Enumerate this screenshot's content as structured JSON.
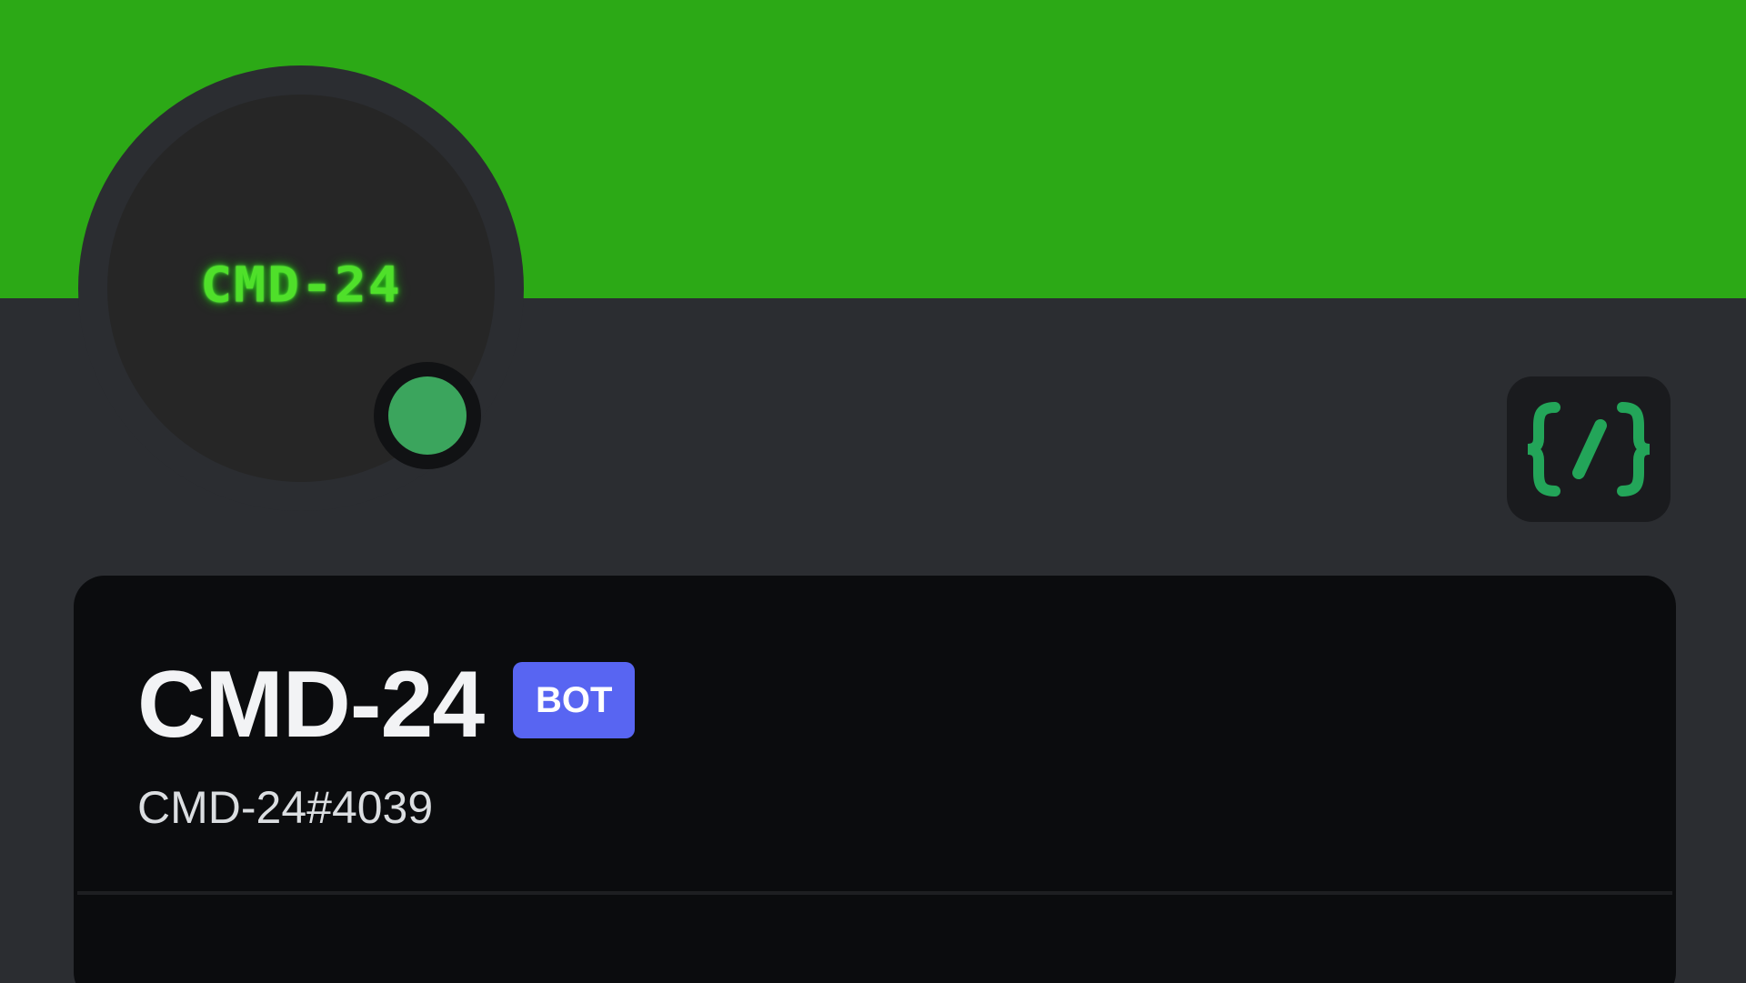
{
  "banner": {
    "color": "#2ca916"
  },
  "avatar": {
    "text": "CMD-24",
    "glow_color": "#4fe02a",
    "status": "online",
    "status_color": "#3ba55d"
  },
  "badge": {
    "icon": "slash-commands-icon",
    "glyph": "{/}",
    "color": "#23a559"
  },
  "profile": {
    "display_name": "CMD-24",
    "bot_tag": "BOT",
    "username": "CMD-24#4039"
  },
  "colors": {
    "background": "#2b2d31",
    "card": "#0b0c0e",
    "bot_tag": "#5865f2"
  }
}
